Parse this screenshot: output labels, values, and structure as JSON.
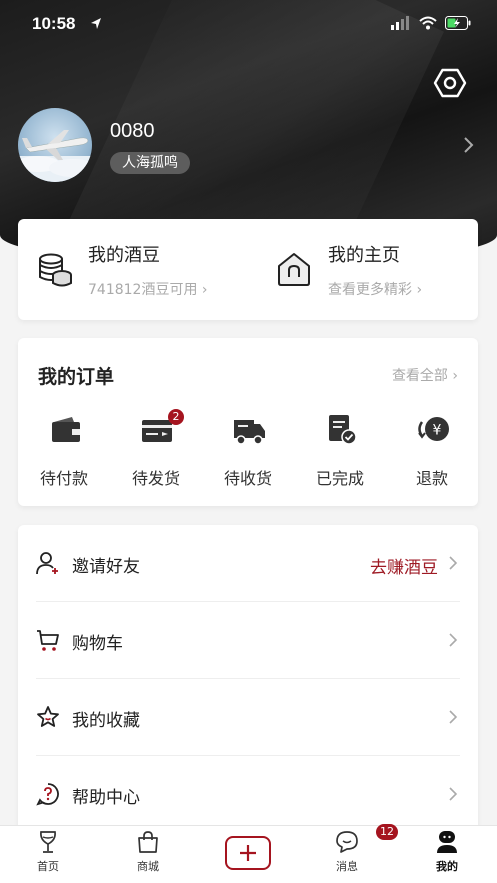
{
  "status_bar": {
    "time": "10:58"
  },
  "profile": {
    "username": "0080",
    "nickname": "人海孤鸣"
  },
  "wallet": {
    "beans_title": "我的酒豆",
    "beans_sub": "741812酒豆可用",
    "home_title": "我的主页",
    "home_sub": "查看更多精彩"
  },
  "orders": {
    "title": "我的订单",
    "view_all": "查看全部",
    "items": [
      {
        "label": "待付款",
        "icon": "wallet-icon"
      },
      {
        "label": "待发货",
        "icon": "card-shipping-icon",
        "badge": "2"
      },
      {
        "label": "待收货",
        "icon": "truck-icon"
      },
      {
        "label": "已完成",
        "icon": "completed-doc-icon"
      },
      {
        "label": "退款",
        "icon": "refund-yen-icon"
      }
    ]
  },
  "menu": {
    "items": [
      {
        "label": "邀请好友",
        "icon": "add-user-icon",
        "extra": "去赚酒豆"
      },
      {
        "label": "购物车",
        "icon": "cart-icon"
      },
      {
        "label": "我的收藏",
        "icon": "star-icon"
      },
      {
        "label": "帮助中心",
        "icon": "help-icon"
      }
    ]
  },
  "tabbar": {
    "items": [
      {
        "label": "首页",
        "icon": "wine-glass-icon"
      },
      {
        "label": "商城",
        "icon": "shopping-bag-icon"
      },
      {
        "label": "",
        "icon": "plus-icon"
      },
      {
        "label": "消息",
        "icon": "chat-icon",
        "badge": "12"
      },
      {
        "label": "我的",
        "icon": "profile-icon"
      }
    ]
  },
  "colors": {
    "accent": "#a5141f",
    "header_dark": "#1c1c1c",
    "invite_text": "#9e1a24"
  }
}
